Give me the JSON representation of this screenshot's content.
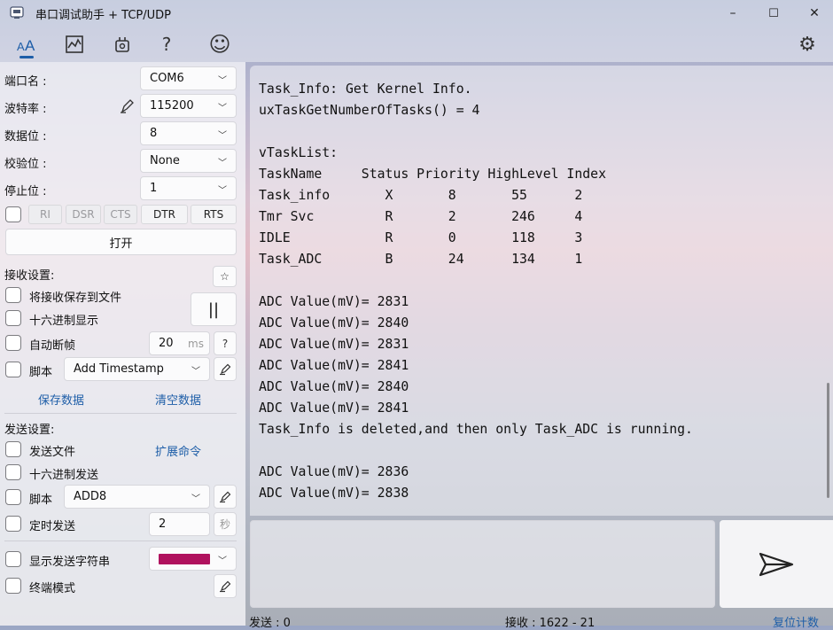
{
  "window": {
    "title": "串口调试助手 + TCP/UDP",
    "min": "–",
    "max": "☐",
    "close": "✕"
  },
  "toolbar": {
    "icons": [
      "text-format-icon",
      "chart-icon",
      "plugin-icon",
      "help-icon",
      "smiley-icon",
      "gear-icon"
    ],
    "help_glyph": "?",
    "smile_glyph": "☺",
    "gear_glyph": "⚙"
  },
  "serial": {
    "port_label": "端口名 :",
    "port_value": "COM6",
    "baud_label": "波特率 :",
    "baud_value": "115200",
    "data_label": "数据位 :",
    "data_value": "8",
    "parity_label": "校验位 :",
    "parity_value": "None",
    "stop_label": "停止位 :",
    "stop_value": "1",
    "signals": [
      "RI",
      "DSR",
      "CTS",
      "DTR",
      "RTS"
    ],
    "open_label": "打开"
  },
  "receive": {
    "title": "接收设置:",
    "save_to_file": "将接收保存到文件",
    "hex_display": "十六进制显示",
    "auto_frame": "自动断帧",
    "frame_value": "20",
    "frame_unit": "ms",
    "frame_help": "?",
    "script_label": "脚本",
    "script_value": "Add Timestamp",
    "pause_glyph": "||",
    "save_data": "保存数据",
    "clear_data": "清空数据",
    "star_glyph": "☆"
  },
  "send": {
    "title": "发送设置:",
    "send_file": "发送文件",
    "ext_cmd": "扩展命令",
    "hex_send": "十六进制发送",
    "script_label": "脚本",
    "script_value": "ADD8",
    "timed_send": "定时发送",
    "timed_value": "2",
    "timed_unit": "秒",
    "show_string": "显示发送字符串",
    "terminal_mode": "终端模式",
    "color": "#b0125e"
  },
  "output": {
    "lines": [
      "Task_Info: Get Kernel Info.",
      "uxTaskGetNumberOfTasks() = 4",
      "",
      "vTaskList:",
      "TaskName     Status Priority HighLevel Index",
      "Task_info       X       8       55      2",
      "Tmr Svc         R       2       246     4",
      "IDLE            R       0       118     3",
      "Task_ADC        B       24      134     1",
      "",
      "ADC Value(mV)= 2831",
      "ADC Value(mV)= 2840",
      "ADC Value(mV)= 2831",
      "ADC Value(mV)= 2841",
      "ADC Value(mV)= 2840",
      "ADC Value(mV)= 2841",
      "Task_Info is deleted,and then only Task_ADC is running.",
      "",
      "ADC Value(mV)= 2836",
      "ADC Value(mV)= 2838"
    ]
  },
  "status": {
    "sent": "发送 : 0",
    "received": "接收 : 1622  -  21",
    "reset": "复位计数"
  }
}
